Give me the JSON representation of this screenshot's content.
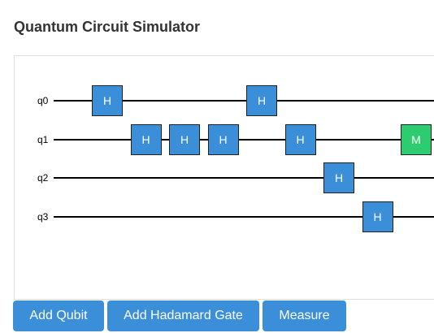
{
  "page": {
    "title": "Quantum Circuit Simulator"
  },
  "colors": {
    "hadamard_gate": "#3a8fd8",
    "measure_gate": "#2ecc71",
    "button": "#3a8fd8",
    "wire": "#000000"
  },
  "circuit": {
    "qubits": [
      {
        "label": "q0",
        "gates": [
          {
            "type": "H",
            "label": "H",
            "slot": 0
          },
          {
            "type": "H",
            "label": "H",
            "slot": 4
          }
        ]
      },
      {
        "label": "q1",
        "gates": [
          {
            "type": "H",
            "label": "H",
            "slot": 1
          },
          {
            "type": "H",
            "label": "H",
            "slot": 2
          },
          {
            "type": "H",
            "label": "H",
            "slot": 3
          },
          {
            "type": "H",
            "label": "H",
            "slot": 5
          },
          {
            "type": "M",
            "label": "M",
            "slot": 8
          }
        ]
      },
      {
        "label": "q2",
        "gates": [
          {
            "type": "H",
            "label": "H",
            "slot": 6
          }
        ]
      },
      {
        "label": "q3",
        "gates": [
          {
            "type": "H",
            "label": "H",
            "slot": 7
          }
        ]
      }
    ]
  },
  "toolbar": {
    "add_qubit_label": "Add Qubit",
    "add_hadamard_label": "Add Hadamard Gate",
    "measure_label": "Measure"
  }
}
